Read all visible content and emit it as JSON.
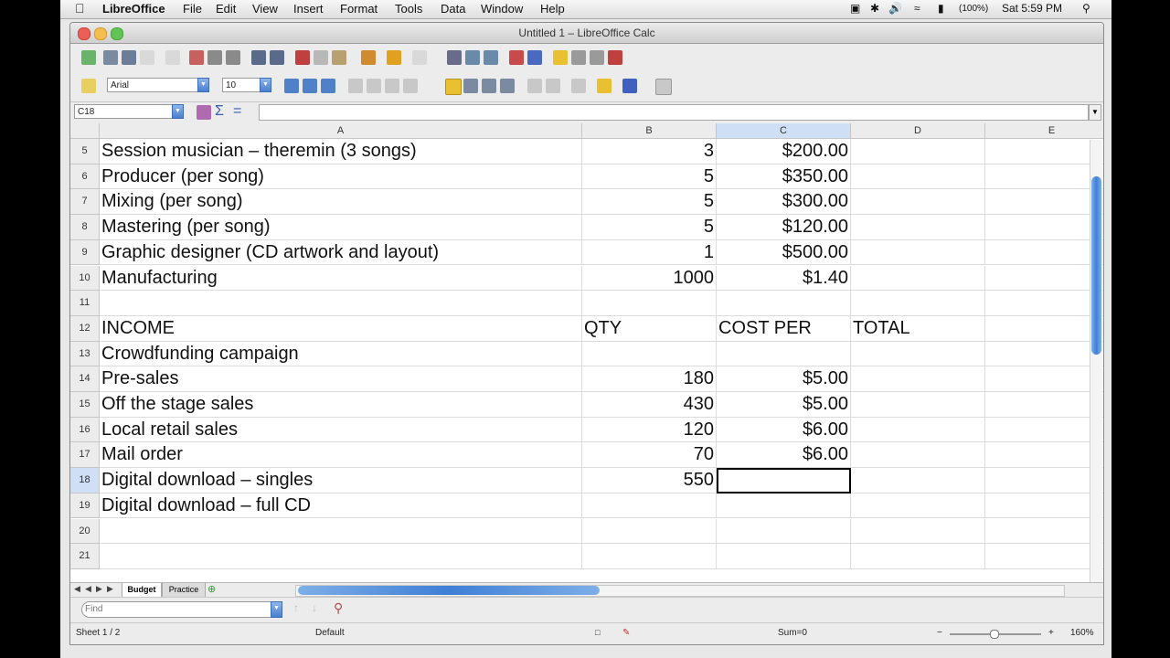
{
  "menubar": {
    "app": "LibreOffice",
    "items": [
      "File",
      "Edit",
      "View",
      "Insert",
      "Format",
      "Tools",
      "Data",
      "Window",
      "Help"
    ],
    "battery": "(100%)",
    "clock": "Sat 5:59 PM"
  },
  "window": {
    "title": "Untitled 1 – LibreOffice Calc"
  },
  "formatting": {
    "font_name": "Arial",
    "font_size": "10"
  },
  "formula_bar": {
    "name_box": "C18",
    "formula": ""
  },
  "columns": [
    "A",
    "B",
    "C",
    "D",
    "E"
  ],
  "selected_cell": "C18",
  "rows": [
    {
      "num": "5",
      "a": "Session musician – theremin (3 songs)",
      "b": "3",
      "c": "$200.00",
      "d": ""
    },
    {
      "num": "6",
      "a": "Producer (per song)",
      "b": "5",
      "c": "$350.00",
      "d": ""
    },
    {
      "num": "7",
      "a": "Mixing (per song)",
      "b": "5",
      "c": "$300.00",
      "d": ""
    },
    {
      "num": "8",
      "a": "Mastering (per song)",
      "b": "5",
      "c": "$120.00",
      "d": ""
    },
    {
      "num": "9",
      "a": "Graphic designer (CD artwork and layout)",
      "b": "1",
      "c": "$500.00",
      "d": ""
    },
    {
      "num": "10",
      "a": "Manufacturing",
      "b": "1000",
      "c": "$1.40",
      "d": ""
    },
    {
      "num": "11",
      "a": "",
      "b": "",
      "c": "",
      "d": ""
    },
    {
      "num": "12",
      "a": "INCOME",
      "b": "QTY",
      "c": "COST PER",
      "d": "TOTAL"
    },
    {
      "num": "13",
      "a": "Crowdfunding campaign",
      "b": "",
      "c": "",
      "d": ""
    },
    {
      "num": "14",
      "a": "Pre-sales",
      "b": "180",
      "c": "$5.00",
      "d": ""
    },
    {
      "num": "15",
      "a": "Off the stage sales",
      "b": "430",
      "c": "$5.00",
      "d": ""
    },
    {
      "num": "16",
      "a": "Local retail sales",
      "b": "120",
      "c": "$6.00",
      "d": ""
    },
    {
      "num": "17",
      "a": "Mail order",
      "b": "70",
      "c": "$6.00",
      "d": ""
    },
    {
      "num": "18",
      "a": "Digital download – singles",
      "b": "550",
      "c": "",
      "d": ""
    },
    {
      "num": "19",
      "a": "Digital download – full CD",
      "b": "",
      "c": "",
      "d": ""
    },
    {
      "num": "20",
      "a": "",
      "b": "",
      "c": "",
      "d": ""
    },
    {
      "num": "21",
      "a": "",
      "b": "",
      "c": "",
      "d": ""
    }
  ],
  "sheet_tabs": [
    "Budget",
    "Practice"
  ],
  "findbar": {
    "placeholder": "Find"
  },
  "status": {
    "sheet": "Sheet 1 / 2",
    "page_style": "Default",
    "sum": "Sum=0",
    "zoom": "160%"
  },
  "colors": {
    "accent": "#3f7fd6",
    "selection_header": "#cfdff5"
  }
}
